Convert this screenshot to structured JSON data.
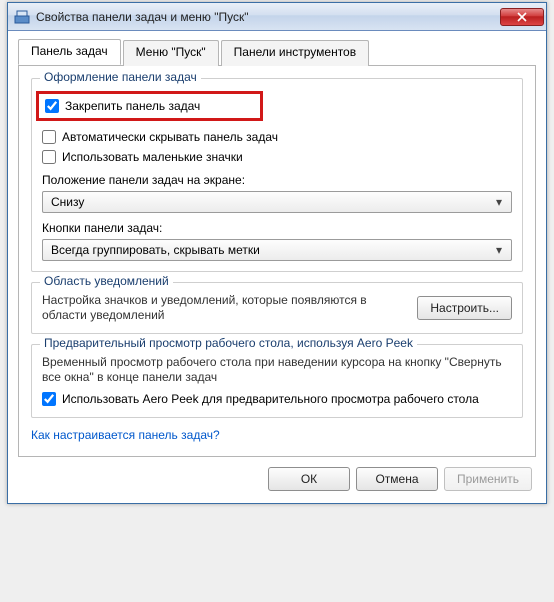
{
  "title": "Свойства панели задач и меню \"Пуск\"",
  "tabs": {
    "taskbar": "Панель задач",
    "startmenu": "Меню \"Пуск\"",
    "toolbars": "Панели инструментов"
  },
  "group_appearance": {
    "legend": "Оформление панели задач",
    "lock": "Закрепить панель задач",
    "autohide": "Автоматически скрывать панель задач",
    "smallicons": "Использовать маленькие значки",
    "position_label": "Положение панели задач на экране:",
    "position_value": "Снизу",
    "buttons_label": "Кнопки панели задач:",
    "buttons_value": "Всегда группировать, скрывать метки"
  },
  "group_notif": {
    "legend": "Область уведомлений",
    "desc": "Настройка значков и уведомлений, которые появляются в области уведомлений",
    "btn": "Настроить..."
  },
  "group_peek": {
    "legend": "Предварительный просмотр рабочего стола, используя Aero Peek",
    "desc": "Временный просмотр рабочего стола при наведении курсора на кнопку \"Свернуть все окна\" в конце панели задач",
    "checkbox": "Использовать Aero Peek для предварительного просмотра рабочего стола"
  },
  "helplink": "Как настраивается панель задач?",
  "footer": {
    "ok": "ОК",
    "cancel": "Отмена",
    "apply": "Применить"
  }
}
